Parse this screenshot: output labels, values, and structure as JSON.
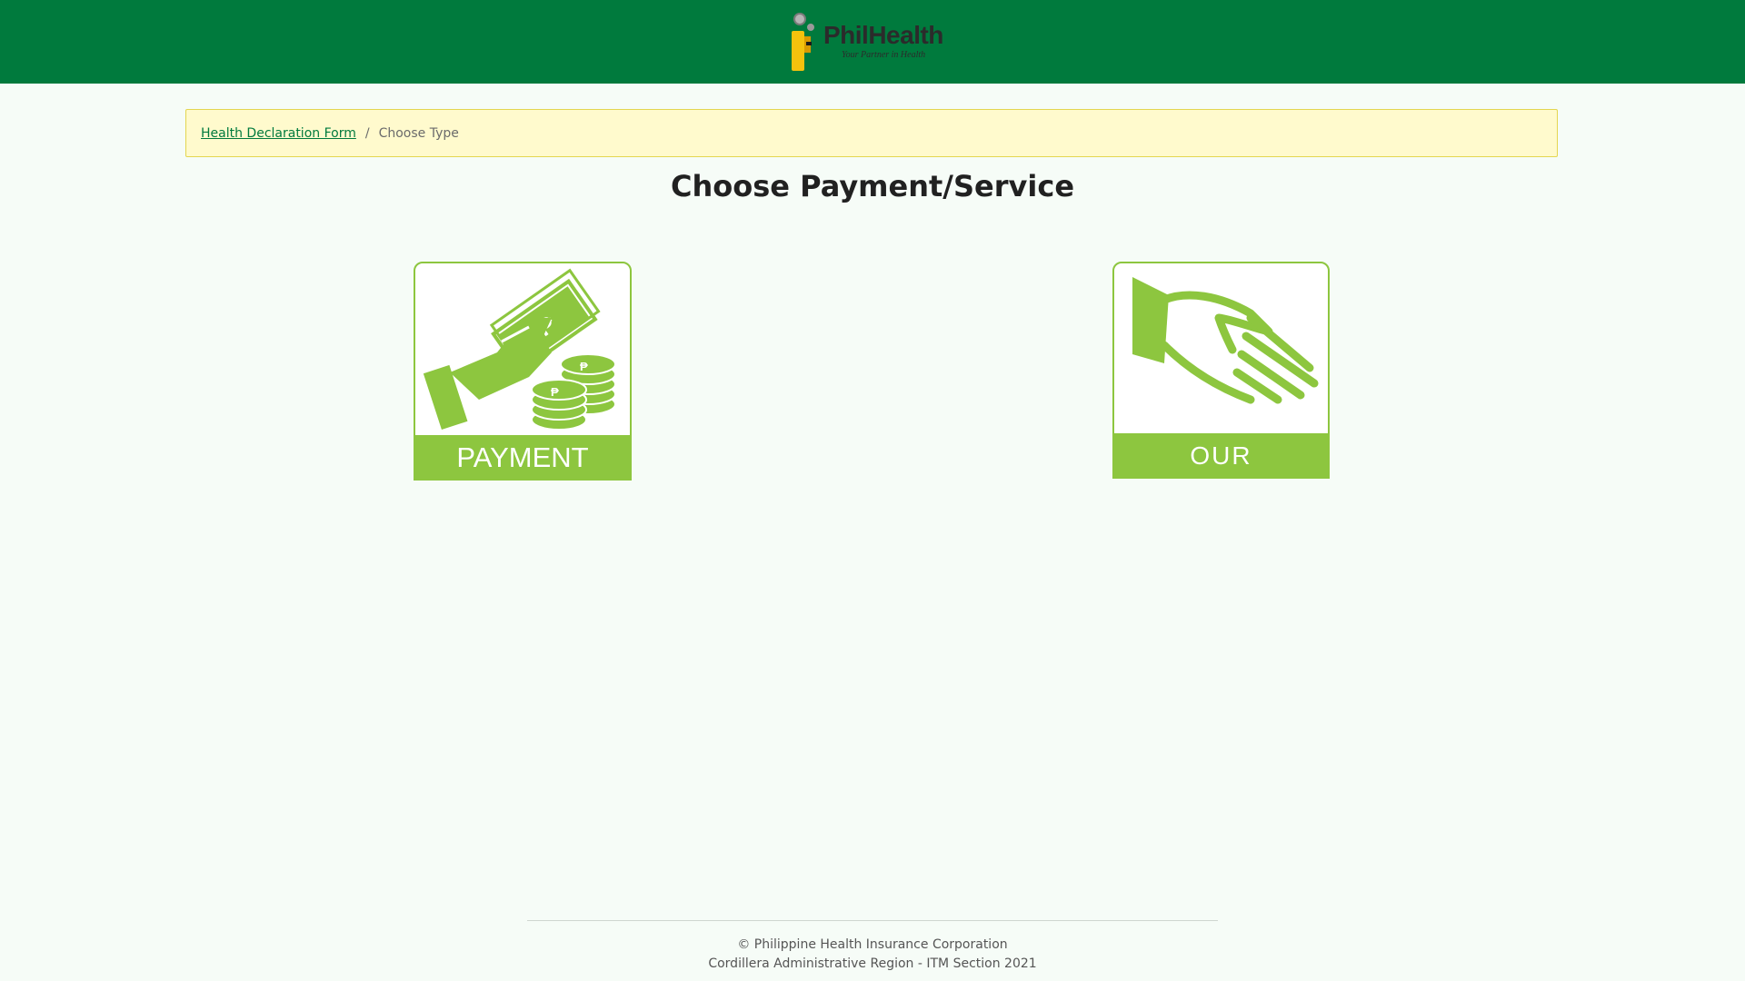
{
  "header": {
    "logo_text": "PhilHealth",
    "logo_tagline": "Your Partner in Health",
    "colors": {
      "bar": "#007a3d"
    }
  },
  "breadcrumb": {
    "items": [
      {
        "label": "Health Declaration Form",
        "link": true
      },
      {
        "label": "Choose Type",
        "link": false
      }
    ],
    "separator": "/"
  },
  "main": {
    "title": "Choose Payment/Service",
    "options": [
      {
        "label": "PAYMENT",
        "icon": "hand-money-icon"
      },
      {
        "label": "OUR SERVICES",
        "icon": "handshake-icon"
      }
    ],
    "colors": {
      "card_accent": "#8dc63f"
    }
  },
  "footer": {
    "line1": "© Philippine Health Insurance Corporation",
    "line2": "Cordillera Administrative Region - ITM Section 2021"
  }
}
